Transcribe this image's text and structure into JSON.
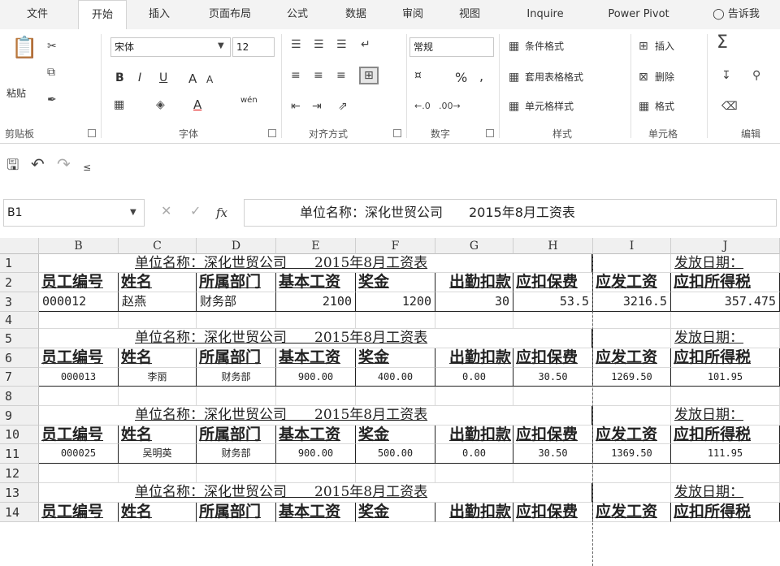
{
  "ribbon_tabs": [
    "文件",
    "开始",
    "插入",
    "页面布局",
    "公式",
    "数据",
    "审阅",
    "视图",
    "Inquire",
    "Power Pivot",
    "告诉我"
  ],
  "clipboard": {
    "paste": "粘贴",
    "label": "剪贴板"
  },
  "font": {
    "name": "宋体",
    "size": "12",
    "bold": "B",
    "italic": "I",
    "underline": "U",
    "grow": "A",
    "shrink": "A",
    "phonetic": "wén",
    "label": "字体"
  },
  "alignment": {
    "label": "对齐方式"
  },
  "number": {
    "format": "常规",
    "percent": "%",
    "comma": ",",
    "label": "数字"
  },
  "styles": {
    "conditional": "条件格式",
    "table": "套用表格格式",
    "cell": "单元格样式",
    "label": "样式"
  },
  "cells": {
    "insert": "插入",
    "delete": "删除",
    "format": "格式",
    "label": "单元格"
  },
  "editing": {
    "label": "编辑"
  },
  "name_box": "B1",
  "formula_fx": "fx",
  "formula_content": "单位名称：深化世贸公司　　2015年8月工资表",
  "columns": [
    "B",
    "C",
    "D",
    "E",
    "F",
    "G",
    "H",
    "I",
    "J"
  ],
  "rows": [
    "1",
    "2",
    "3",
    "4",
    "5",
    "6",
    "7",
    "8",
    "9",
    "10",
    "11",
    "12",
    "13",
    "14"
  ],
  "title_text": "单位名称：深化世贸公司　　2015年8月工资表",
  "issue_date_label": "发放日期：",
  "headers": [
    "员工编号",
    "姓名",
    "所属部门",
    "基本工资",
    "奖金",
    "出勤扣款",
    "应扣保费",
    "应发工资",
    "应扣所得税"
  ],
  "records": [
    [
      "000012",
      "赵燕",
      "财务部",
      "2100",
      "1200",
      "30",
      "53.5",
      "3216.5",
      "357.475"
    ],
    [
      "000013",
      "李丽",
      "财务部",
      "900.00",
      "400.00",
      "0.00",
      "30.50",
      "1269.50",
      "101.95"
    ],
    [
      "000025",
      "吴明英",
      "财务部",
      "900.00",
      "500.00",
      "0.00",
      "30.50",
      "1369.50",
      "111.95"
    ]
  ]
}
